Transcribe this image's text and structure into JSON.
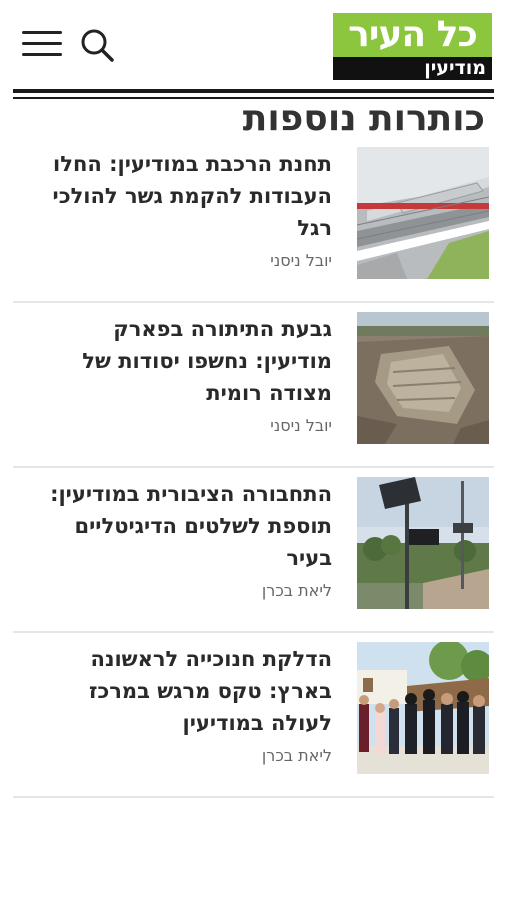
{
  "header": {
    "logo_top": "כל העיר",
    "logo_bottom": "מודיעין",
    "menu_icon": "hamburger-menu-icon",
    "search_icon": "search-icon",
    "brand_color": "#8cc63e"
  },
  "section": {
    "title": "כותרות נוספות"
  },
  "articles": [
    {
      "headline": "תחנת הרכבת במודיעין: החלו העבודות להקמת גשר להולכי רגל",
      "author": "יובל ניסני"
    },
    {
      "headline": "גבעת התיתורה בפארק מודיעין: נחשפו יסודות של מצודה רומית",
      "author": "יובל ניסני"
    },
    {
      "headline": "התחבורה הציבורית במודיעין: תוספת לשלטים הדיגיטליים בעיר",
      "author": "ליאת בכרן"
    },
    {
      "headline": "הדלקת חנוכייה לראשונה בארץ: טקס מרגש במרכז לעולה במודיעין",
      "author": "ליאת בכרן"
    }
  ]
}
